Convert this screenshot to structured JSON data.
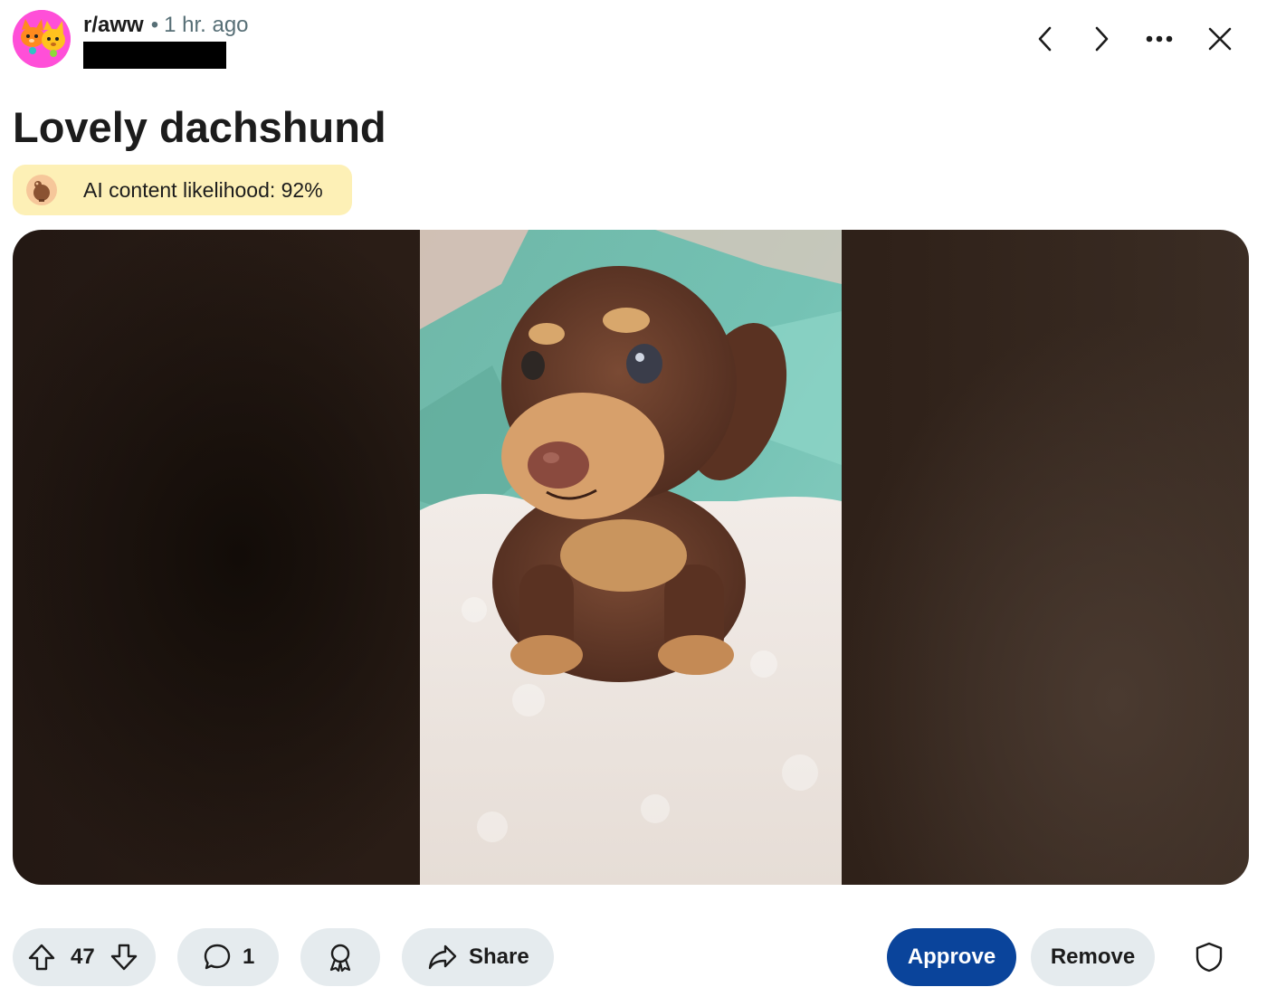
{
  "header": {
    "subreddit": "r/aww",
    "separator": "•",
    "time": "1 hr. ago"
  },
  "post": {
    "title": "Lovely dachshund",
    "ai_badge": "AI content likelihood: 92%"
  },
  "actions": {
    "upvotes": "47",
    "comments": "1",
    "share_label": "Share",
    "approve_label": "Approve",
    "remove_label": "Remove"
  },
  "icons": {
    "back": "chevron-left-icon",
    "forward": "chevron-right-icon",
    "more": "more-horizontal-icon",
    "close": "close-icon",
    "upvote": "arrow-up-icon",
    "downvote": "arrow-down-icon",
    "comment": "comment-icon",
    "award": "award-icon",
    "share": "share-arrow-icon",
    "mod": "shield-icon"
  },
  "colors": {
    "approve": "#0a449b",
    "pill_bg": "#e5ebee",
    "ai_badge_bg": "#fdf0b6",
    "avatar_bg": "#ff4fd8"
  }
}
